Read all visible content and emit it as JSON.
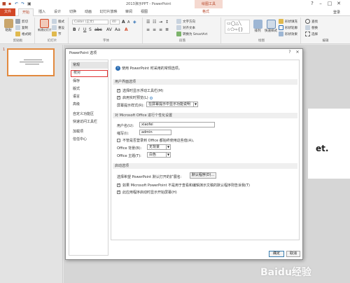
{
  "window": {
    "title": "2013演示PPT - PowerPoint",
    "contextual_tab": "绘图工具",
    "login": "登录"
  },
  "tabs": [
    "文件",
    "开始",
    "插入",
    "设计",
    "切换",
    "动画",
    "幻灯片放映",
    "审阅",
    "视图",
    "格式"
  ],
  "ribbon": {
    "clipboard": {
      "label": "剪贴板",
      "paste": "粘贴",
      "cut": "剪切",
      "copy": "复制",
      "format_painter": "格式刷"
    },
    "slides": {
      "label": "幻灯片",
      "new_slide": "新建幻灯片",
      "layout": "版式",
      "reset": "重设",
      "section": "节"
    },
    "font": {
      "label": "字体",
      "font_name": "Calibri (正文)",
      "font_size": "40"
    },
    "paragraph": {
      "label": "段落",
      "text_direction": "文字方向",
      "align_text": "对齐文本",
      "convert_smartart": "转换为 SmartArt"
    },
    "drawing": {
      "label": "绘图",
      "arrange": "排列",
      "quick_styles": "快速样式"
    },
    "drawing_fmt": {
      "fill": "形状填充",
      "outline": "形状轮廓",
      "effects": "形状效果"
    },
    "editing": {
      "label": "编辑",
      "find": "查找",
      "replace": "替换",
      "select": "选择"
    }
  },
  "slide_panel": {
    "slide_number": "1"
  },
  "slide_peek_text": "et.",
  "dialog": {
    "title": "PowerPoint 选项",
    "nav": [
      "常规",
      "校对",
      "保存",
      "版式",
      "语言",
      "高级",
      "自定义功能区",
      "快速访问工具栏",
      "加载项",
      "信任中心"
    ],
    "intro": "使用 PowerPoint 时采用的常规选项。",
    "ui_section": "用户界面选项",
    "show_minitoolbar": "选择时显示浮动工具栏(M)",
    "enable_live_preview": "启用实时预览(L)",
    "tooltip_style_label": "屏幕提示样式(R):",
    "tooltip_style_value": "在屏幕提示中显示功能说明",
    "personalize_section": "对 Microsoft Office 进行个性化设置",
    "username_label": "用户名(U):",
    "username_value": "xiaofei",
    "initials_label": "缩写(I):",
    "initials_value": "admin",
    "always_use_label": "不管是否登录到 Office 都始终使用这些值(A)。",
    "bg_label": "Office 背景(B):",
    "bg_value": "无背景",
    "theme_label": "Office 主题(T):",
    "theme_value": "白色",
    "startup_section": "启动选项",
    "default_ext_label": "选择希望 PowerPoint 默认打开的扩展名:",
    "default_programs_button": "默认程序(D)...",
    "default_viewer_label": "如果 Microsoft PowerPoint 不是用于查看和编辑演示文稿的默认程序则告诉我(T)",
    "show_start_screen": "此应用程序启动时显示开始屏幕(H)",
    "ok": "确定",
    "cancel": "取消"
  },
  "watermark": "Baidu经验",
  "colors": {
    "accent": "#d24726",
    "selection_border": "#e2893e",
    "nav_box": "#e03030"
  }
}
